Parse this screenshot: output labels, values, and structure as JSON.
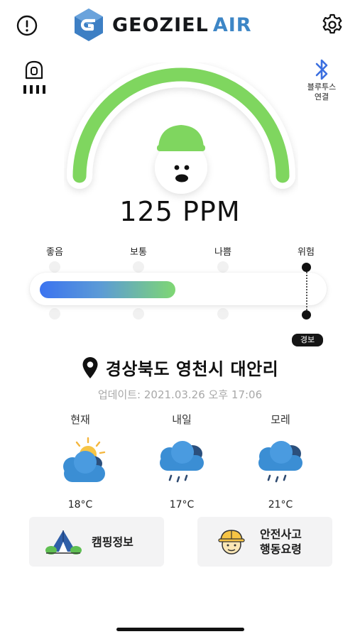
{
  "header": {
    "brand_primary": "GEOZIEL",
    "brand_secondary": "AIR",
    "brand_color": "#3d86c6",
    "info_icon": "info-icon",
    "settings_icon": "gear-icon"
  },
  "device": {
    "sensor_icon": "gas-sensor-icon",
    "bluetooth_label": "블루투스\n연결",
    "bluetooth_color": "#3b6fe0"
  },
  "reading": {
    "value_text": "125 PPM",
    "gauge_color": "#7fd65f"
  },
  "levels": {
    "labels": [
      "좋음",
      "보통",
      "나쁨",
      "위험"
    ],
    "fill_fraction": 0.47,
    "alarm_label": "경보"
  },
  "location": {
    "name": "경상북도 영천시 대안리",
    "updated": "업데이트: 2021.03.26 오후 17:06"
  },
  "forecast": [
    {
      "day": "현재",
      "temp": "18°C",
      "icon": "partly-cloudy-icon"
    },
    {
      "day": "내일",
      "temp": "17°C",
      "icon": "rain-cloud-icon"
    },
    {
      "day": "모레",
      "temp": "21°C",
      "icon": "rain-cloud-icon"
    }
  ],
  "actions": {
    "camping_label": "캠핑정보",
    "safety_label": "안전사고\n행동요령"
  }
}
